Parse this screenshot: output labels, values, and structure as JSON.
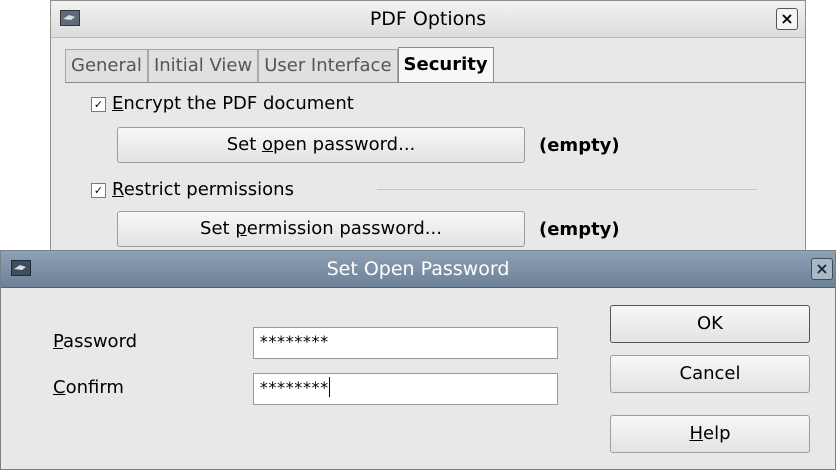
{
  "pdf_options": {
    "title": "PDF Options",
    "close": "×",
    "tabs": [
      {
        "label": "General"
      },
      {
        "label": "Initial View"
      },
      {
        "label": "User Interface"
      },
      {
        "label": "Security",
        "active": true
      }
    ],
    "security": {
      "encrypt": {
        "label_u": "E",
        "label_rest": "ncrypt the PDF document",
        "checked": true
      },
      "open_password_button": {
        "pre": "Set ",
        "u": "o",
        "post": "pen password..."
      },
      "open_password_status": "(empty)",
      "restrict": {
        "label_u": "R",
        "label_rest": "estrict permissions",
        "checked": true
      },
      "permission_password_button": {
        "pre": "Set ",
        "u": "p",
        "post": "ermission password..."
      },
      "permission_password_status": "(empty)"
    }
  },
  "set_open_password": {
    "title": "Set Open Password",
    "close": "×",
    "password": {
      "label_u": "P",
      "label_rest": "assword",
      "value": "********"
    },
    "confirm": {
      "label_u": "C",
      "label_rest": "onfirm",
      "value": "********"
    },
    "buttons": {
      "ok": "OK",
      "cancel": "Cancel",
      "help_u": "H",
      "help_rest": "elp"
    }
  },
  "colors": {
    "dialog_bg": "#e8e8e7",
    "active_titlebar": "#7a8da3",
    "inactive_titlebar": "#e4e4e3"
  },
  "icons": {
    "window_icon": "app-window-icon",
    "checkbox": "check-icon"
  }
}
